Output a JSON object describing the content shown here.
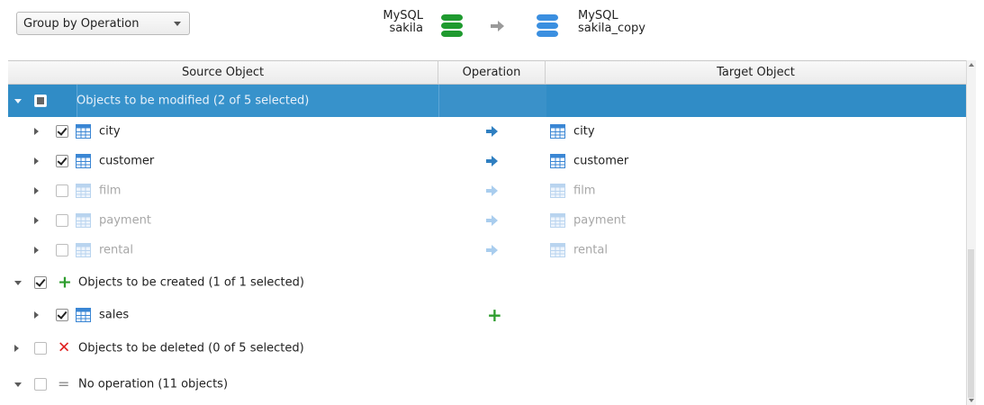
{
  "toolbar": {
    "group_by": "Group by Operation"
  },
  "source_db": {
    "engine": "MySQL",
    "name": "sakila",
    "icon": "database-icon-green",
    "color": "#1f9a2f"
  },
  "target_db": {
    "engine": "MySQL",
    "name": "sakila_copy",
    "icon": "database-icon-blue",
    "color": "#3b8fe0"
  },
  "columns": {
    "source": "Source Object",
    "operation": "Operation",
    "target": "Target Object"
  },
  "groups": [
    {
      "label": "Objects to be modified (2 of 5 selected)",
      "expanded": true,
      "check": "partial",
      "selected": true,
      "items": [
        {
          "name": "city",
          "checked": true,
          "target": "city"
        },
        {
          "name": "customer",
          "checked": true,
          "target": "customer"
        },
        {
          "name": "film",
          "checked": false,
          "target": "film"
        },
        {
          "name": "payment",
          "checked": false,
          "target": "payment"
        },
        {
          "name": "rental",
          "checked": false,
          "target": "rental"
        }
      ]
    },
    {
      "label": "Objects to be created (1 of 1 selected)",
      "expanded": true,
      "check": "on",
      "icon": "plus-icon",
      "items": [
        {
          "name": "sales",
          "checked": true
        }
      ]
    },
    {
      "label": "Objects to be deleted (0 of 5 selected)",
      "expanded": false,
      "check": "off",
      "icon": "x-icon"
    },
    {
      "label": "No operation (11 objects)",
      "expanded": true,
      "check": "off",
      "icon": "equals-icon"
    }
  ],
  "colors": {
    "selection": "#308cc6",
    "arrow_active": "#2f7fc1",
    "arrow_inactive": "#a9cdee",
    "create": "#2e9d2e",
    "delete": "#e02020"
  }
}
